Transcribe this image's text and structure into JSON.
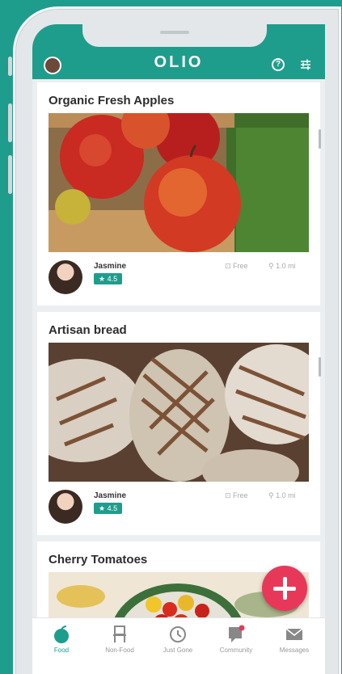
{
  "header": {
    "title": "OLIO",
    "help_glyph": "?",
    "icons": {
      "profile": "profile-avatar",
      "help": "help-circle-icon",
      "filter": "filter-sliders-icon"
    }
  },
  "listings": [
    {
      "title": "Organic Fresh Apples",
      "user": "Jasmine",
      "rating": "★ 4.5",
      "price": "⊡ Free",
      "distance": "⚲ 1.0 mi"
    },
    {
      "title": "Artisan bread",
      "user": "Jasmine",
      "rating": "★ 4.5",
      "price": "⊡ Free",
      "distance": "⚲ 1.0 mi"
    },
    {
      "title": "Cherry Tomatoes"
    }
  ],
  "nav": {
    "items": [
      {
        "label": "Food",
        "icon": "apple-icon",
        "active": true
      },
      {
        "label": "Non-Food",
        "icon": "chair-icon"
      },
      {
        "label": "Just Gone",
        "icon": "history-icon"
      },
      {
        "label": "Community",
        "icon": "community-icon"
      },
      {
        "label": "Messages",
        "icon": "envelope-icon"
      }
    ]
  },
  "colors": {
    "brand": "#1f9d8c",
    "fab": "#e8385a"
  }
}
